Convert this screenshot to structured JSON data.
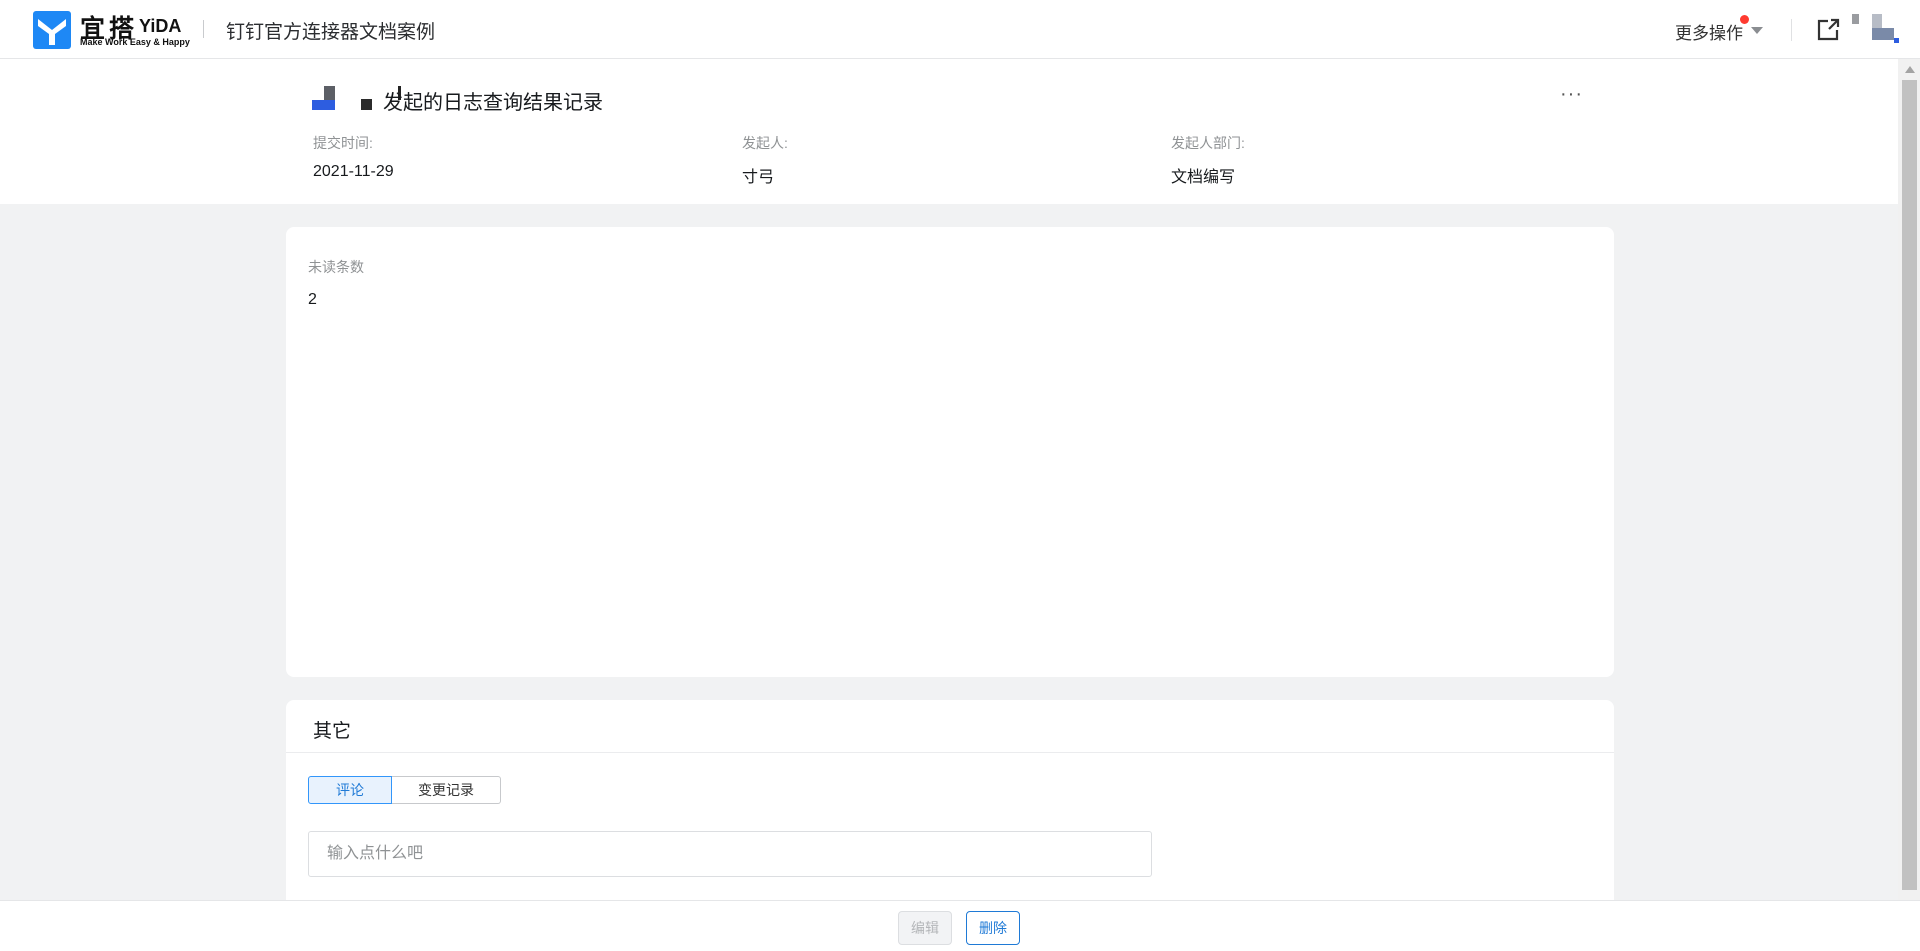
{
  "brand": {
    "name_cn": "宜搭",
    "name_en": "YiDA",
    "slogan": "Make Work Easy & Happy",
    "logo_icon": "yida-logo-icon",
    "color": "#1e88f5"
  },
  "topbar": {
    "app_title": "钉钉官方连接器文档案例",
    "more_actions_label": "更多操作",
    "notification_dot_color": "#ff3b30",
    "share_icon": "external-link-icon",
    "avatar_icon": "user-avatar-icon"
  },
  "header": {
    "form_title": "发起的日志查询结果记录",
    "more_icon": "ellipsis-icon",
    "meta": [
      {
        "label": "提交时间:",
        "value": "2021-11-29"
      },
      {
        "label": "发起人:",
        "value": "寸弓"
      },
      {
        "label": "发起人部门:",
        "value": "文档编写"
      }
    ]
  },
  "main_card": {
    "field_label": "未读条数",
    "field_value": "2"
  },
  "other_card": {
    "title": "其它",
    "tabs": [
      {
        "label": "评论",
        "active": true
      },
      {
        "label": "变更记录",
        "active": false
      }
    ],
    "comment_placeholder": "输入点什么吧"
  },
  "footer": {
    "edit_label": "编辑",
    "delete_label": "删除",
    "accent_color": "#1f7ad6"
  }
}
